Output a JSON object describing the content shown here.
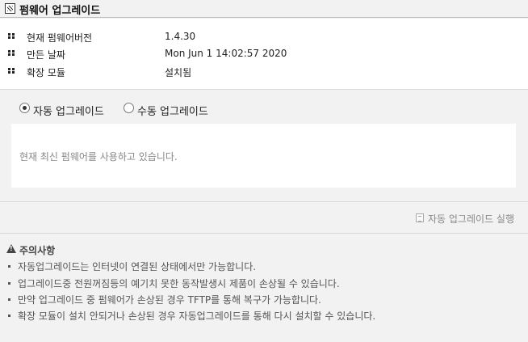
{
  "header": {
    "title": "펌웨어 업그레이드"
  },
  "info": {
    "rows": [
      {
        "label": "현재 펌웨어버전",
        "value": "1.4.30"
      },
      {
        "label": "만든 날짜",
        "value": "Mon Jun 1 14:02:57 2020"
      },
      {
        "label": "확장 모듈",
        "value": "설치됨"
      }
    ]
  },
  "mode": {
    "options": [
      {
        "label": "자동 업그레이드",
        "checked": true
      },
      {
        "label": "수동 업그레이드",
        "checked": false
      }
    ],
    "status_text": "현재 최신 펌웨어를 사용하고 있습니다."
  },
  "actions": {
    "run_label": "자동 업그레이드 실행"
  },
  "notes": {
    "title": "주의사항",
    "items": [
      "자동업그레이드는 인터넷이 연결된 상태에서만 가능합니다.",
      "업그레이드중 전원꺼짐등의 예기치 못한 동작발생시 제품이 손상될 수 있습니다.",
      "만약 업그레이드 중 펌웨어가 손상된 경우 TFTP를 통해 복구가 가능합니다.",
      "확장 모듈이 설치 안되거나 손상된 경우 자동업그레이드를 통해 다시 설치할 수 있습니다."
    ]
  }
}
